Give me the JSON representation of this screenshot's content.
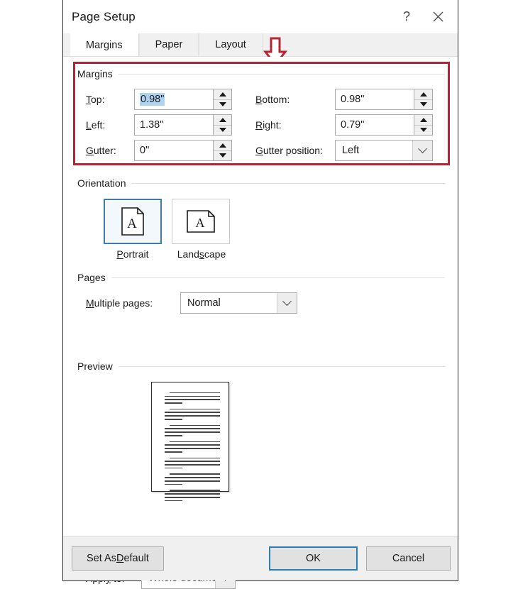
{
  "window": {
    "title": "Page Setup",
    "help_label": "?",
    "close_label": "✕"
  },
  "tabs": [
    {
      "label": "Margins",
      "active": true
    },
    {
      "label": "Paper",
      "active": false
    },
    {
      "label": "Layout",
      "active": false
    }
  ],
  "annotation": {
    "arrow_color": "#b52432",
    "box_color": "#b52432",
    "arrow_icon": "down-arrow-icon"
  },
  "margins": {
    "legend": "Margins",
    "top": {
      "label": "Top:",
      "mnemonic": "T",
      "value": "0.98\"",
      "selected": true
    },
    "bottom": {
      "label": "Bottom:",
      "mnemonic": "B",
      "value": "0.98\"",
      "selected": false
    },
    "left": {
      "label": "Left:",
      "mnemonic": "L",
      "value": "1.38\"",
      "selected": false
    },
    "right": {
      "label": "Right:",
      "mnemonic": "R",
      "value": "0.79\"",
      "selected": false
    },
    "gutter": {
      "label": "Gutter:",
      "mnemonic": "G",
      "value": "0\"",
      "selected": false
    },
    "gutter_position": {
      "label": "Gutter position:",
      "mnemonic": "G",
      "value": "Left"
    },
    "selection_color": "#aed4f0"
  },
  "orientation": {
    "legend": "Orientation",
    "portrait": {
      "label": "Portrait",
      "mnemonic": "P",
      "selected": true,
      "icon": "portrait-page-icon"
    },
    "landscape": {
      "label": "Landscape",
      "mnemonic": "s",
      "selected": false,
      "icon": "landscape-page-icon"
    },
    "selected_border_color": "#3d7ca8"
  },
  "pages": {
    "legend": "Pages",
    "multiple_pages": {
      "label": "Multiple pages:",
      "mnemonic": "M",
      "value": "Normal"
    }
  },
  "preview": {
    "legend": "Preview",
    "page_paragraphs": 7
  },
  "apply": {
    "label": "Apply to:",
    "mnemonic": "y",
    "value": "Whole document"
  },
  "footer": {
    "set_default": "Set As Default",
    "set_default_mnemonic": "D",
    "ok": "OK",
    "cancel": "Cancel",
    "primary_color": "#2d7dbb"
  }
}
